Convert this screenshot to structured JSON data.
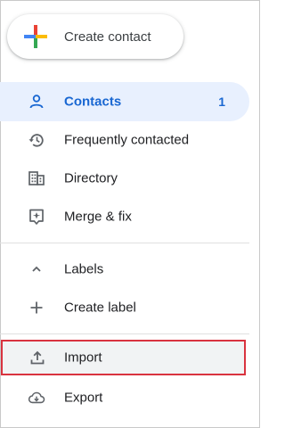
{
  "create_button": {
    "label": "Create contact",
    "icon": "multicolor-plus-icon"
  },
  "nav": {
    "contacts": {
      "label": "Contacts",
      "count": "1",
      "icon": "person-icon"
    },
    "frequently_contacted": {
      "label": "Frequently contacted",
      "icon": "history-icon"
    },
    "directory": {
      "label": "Directory",
      "icon": "building-icon"
    },
    "merge_fix": {
      "label": "Merge & fix",
      "icon": "merge-fix-icon"
    }
  },
  "labels_section": {
    "header": {
      "label": "Labels",
      "icon": "chevron-up-icon"
    },
    "create_label": {
      "label": "Create label",
      "icon": "plus-icon"
    }
  },
  "actions": {
    "import": {
      "label": "Import",
      "icon": "upload-icon"
    },
    "export": {
      "label": "Export",
      "icon": "cloud-download-icon"
    }
  },
  "colors": {
    "active_bg": "#e8f0fe",
    "active_text": "#1967d2",
    "highlight_border": "#d9333f",
    "icon_gray": "#5f6368"
  }
}
